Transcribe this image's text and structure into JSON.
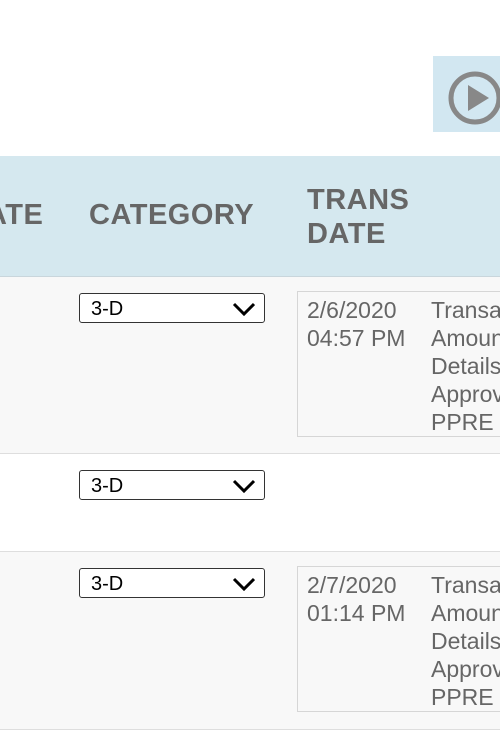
{
  "toolbar": {
    "play_icon": "play-circle-icon"
  },
  "columns": {
    "date_partial": "ATE",
    "category": "CATEGORY",
    "trans_date_line1": "TRANS",
    "trans_date_line2": "DATE"
  },
  "rows": [
    {
      "category": "3-D",
      "trans_date": "2/6/2020",
      "trans_time": "04:57 PM",
      "desc": [
        "Transa",
        "Amoun",
        "Details",
        "Approv",
        "PPRE"
      ]
    },
    {
      "category": "3-D"
    },
    {
      "category": "3-D",
      "trans_date": "2/7/2020",
      "trans_time": "01:14 PM",
      "desc": [
        "Transa",
        "Amoun",
        "Details",
        "Approv",
        "PPRE"
      ]
    }
  ]
}
